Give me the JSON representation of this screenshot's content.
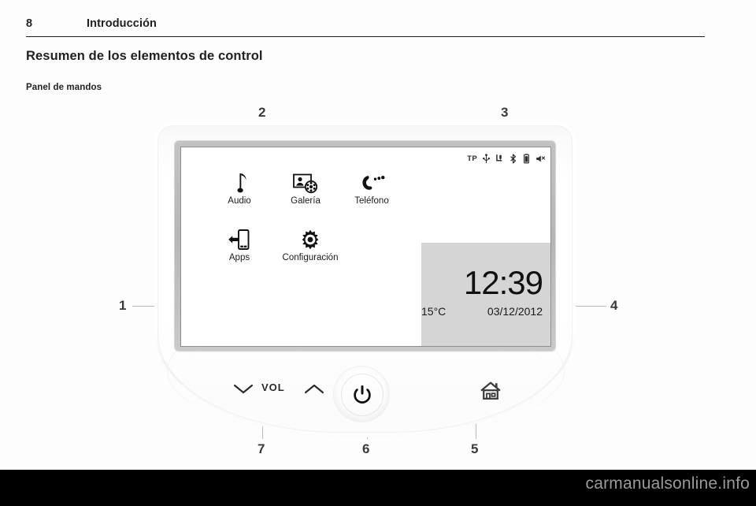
{
  "page": {
    "number": "8",
    "chapter_title": "Introducción",
    "section_heading": "Resumen de los elementos de control",
    "sub_heading": "Panel de mandos",
    "watermark": "carmanualsonline.info"
  },
  "figure": {
    "callouts": [
      {
        "id": "callout-1",
        "label": "1"
      },
      {
        "id": "callout-2",
        "label": "2"
      },
      {
        "id": "callout-3",
        "label": "3"
      },
      {
        "id": "callout-4",
        "label": "4"
      },
      {
        "id": "callout-5",
        "label": "5"
      },
      {
        "id": "callout-6",
        "label": "6"
      },
      {
        "id": "callout-7",
        "label": "7"
      }
    ]
  },
  "screen": {
    "status_bar": {
      "tp_label": "TP",
      "icons": [
        "usb-icon",
        "aux-input-icon",
        "bluetooth-icon",
        "phone-battery-icon",
        "mute-speaker-icon"
      ]
    },
    "menu": {
      "row1": [
        {
          "icon": "music-note-icon",
          "label": "Audio"
        },
        {
          "icon": "gallery-icon",
          "label": "Galería"
        },
        {
          "icon": "phone-handset-icon",
          "label": "Teléfono"
        }
      ],
      "row2": [
        {
          "icon": "smartphone-apps-icon",
          "label": "Apps"
        },
        {
          "icon": "gear-icon",
          "label": "Configuración"
        }
      ]
    },
    "info_panel": {
      "time": "12:39",
      "temperature": "15°C",
      "date": "03/12/2012"
    }
  },
  "controls": {
    "volume_down": "chevron-down-icon",
    "volume_label": "VOL",
    "volume_up": "chevron-up-icon",
    "power": "power-icon",
    "home": "home-icon"
  },
  "colors": {
    "ink": "#231f20",
    "panel_gray": "#d5d5d5",
    "bezel_gray": "#bcbcbc",
    "leader_line": "#b9b9b9",
    "watermark": "#9a9a9a"
  }
}
